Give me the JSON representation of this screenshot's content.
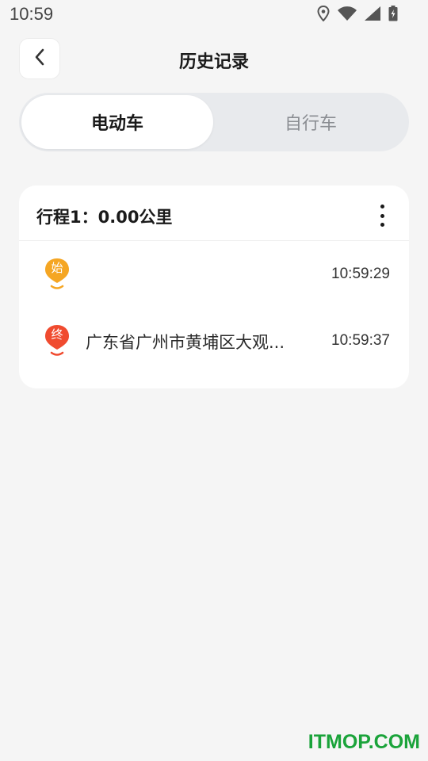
{
  "status_bar": {
    "time": "10:59",
    "icons": [
      "location-icon",
      "wifi-icon",
      "signal-icon",
      "battery-icon"
    ]
  },
  "header": {
    "title": "历史记录",
    "back_icon": "chevron-left-icon"
  },
  "tabs": [
    {
      "label": "电动车",
      "active": true
    },
    {
      "label": "自行车",
      "active": false
    }
  ],
  "trips": [
    {
      "title": "行程1：0.00公里",
      "more_icon": "more-vertical-icon",
      "start": {
        "marker_label": "始",
        "marker_color": "#f5a623",
        "address": "",
        "time": "10:59:29"
      },
      "end": {
        "marker_label": "终",
        "marker_color": "#f04b2f",
        "address": "广东省广州市黄埔区大观...",
        "time": "10:59:37"
      }
    }
  ],
  "watermark": "ITMOP.COM"
}
